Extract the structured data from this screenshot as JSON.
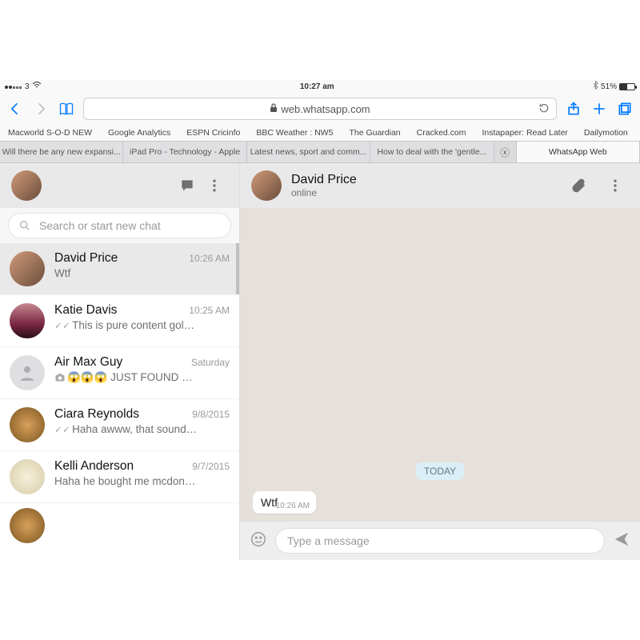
{
  "statusbar": {
    "carrier": "3",
    "wifi": "wifi",
    "time": "10:27 am",
    "bt": "bt",
    "batt_pct": "51%"
  },
  "safari": {
    "url_host": "web.whatsapp.com",
    "favorites": [
      "Macworld S-O-D NEW",
      "Google Analytics",
      "ESPN Cricinfo",
      "BBC Weather : NW5",
      "The Guardian",
      "Cracked.com",
      "Instapaper: Read Later",
      "Dailymotion"
    ],
    "tabs": [
      "Will there be any new expansi...",
      "iPad Pro - Technology - Apple",
      "Latest news, sport and comm...",
      "How to deal with the 'gentle..."
    ],
    "active_tab": "WhatsApp Web"
  },
  "sidebar": {
    "search_placeholder": "Search or start new chat",
    "items": [
      {
        "name": "David Price",
        "time": "10:26 AM",
        "preview": "Wtf",
        "selected": true,
        "avatar": "v1"
      },
      {
        "name": "Katie Davis",
        "time": "10:25 AM",
        "preview": "This is pure content gol…",
        "ticks": true,
        "avatar": "v2"
      },
      {
        "name": "Air Max Guy",
        "time": "Saturday",
        "preview": "😱😱😱 JUST FOUND …",
        "camera": true,
        "avatar": "grey"
      },
      {
        "name": "Ciara Reynolds",
        "time": "9/8/2015",
        "preview": "Haha awww, that sound…",
        "ticks": true,
        "avatar": "v3"
      },
      {
        "name": "Kelli Anderson",
        "time": "9/7/2015",
        "preview": "Haha he bought me mcdon…",
        "avatar": "v4"
      }
    ]
  },
  "conversation": {
    "name": "David Price",
    "status": "online",
    "date_chip": "TODAY",
    "messages": [
      {
        "text": "Wtf",
        "time": "10:26 AM"
      }
    ],
    "input_placeholder": "Type a message"
  }
}
